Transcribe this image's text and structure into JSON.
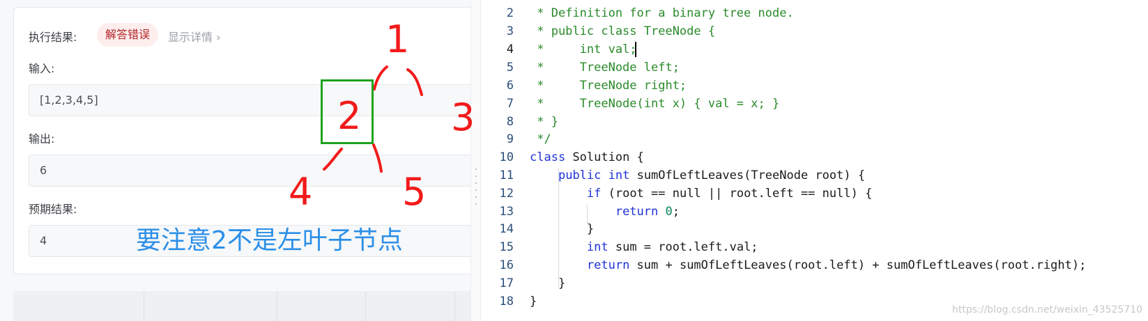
{
  "result_panel": {
    "exec_label": "执行结果:",
    "status_badge": "解答错误",
    "details_link": "显示详情 ›",
    "input_label": "输入:",
    "input_value": "[1,2,3,4,5]",
    "output_label": "输出:",
    "output_value": "6",
    "expected_label": "预期结果:",
    "expected_value": "4"
  },
  "editor": {
    "line_numbers": [
      "2",
      "3",
      "4",
      "5",
      "6",
      "7",
      "8",
      "9",
      "10",
      "11",
      "12",
      "13",
      "14",
      "15",
      "16",
      "17",
      "18"
    ],
    "active_line": "4",
    "watermark": "https://blog.csdn.net/weixin_43525710"
  },
  "annotations": {
    "node_1": "1",
    "node_2": "2",
    "node_3": "3",
    "node_4": "4",
    "node_5": "5",
    "note": "要注意2不是左叶子节点"
  },
  "colors": {
    "error_text": "#b2262a",
    "annotation_red": "#f21a1a",
    "annotation_green": "#1ea21e",
    "annotation_blue": "#2b8fe8",
    "keyword_blue": "#1f32d6",
    "comment_green": "#2a8a2a"
  }
}
